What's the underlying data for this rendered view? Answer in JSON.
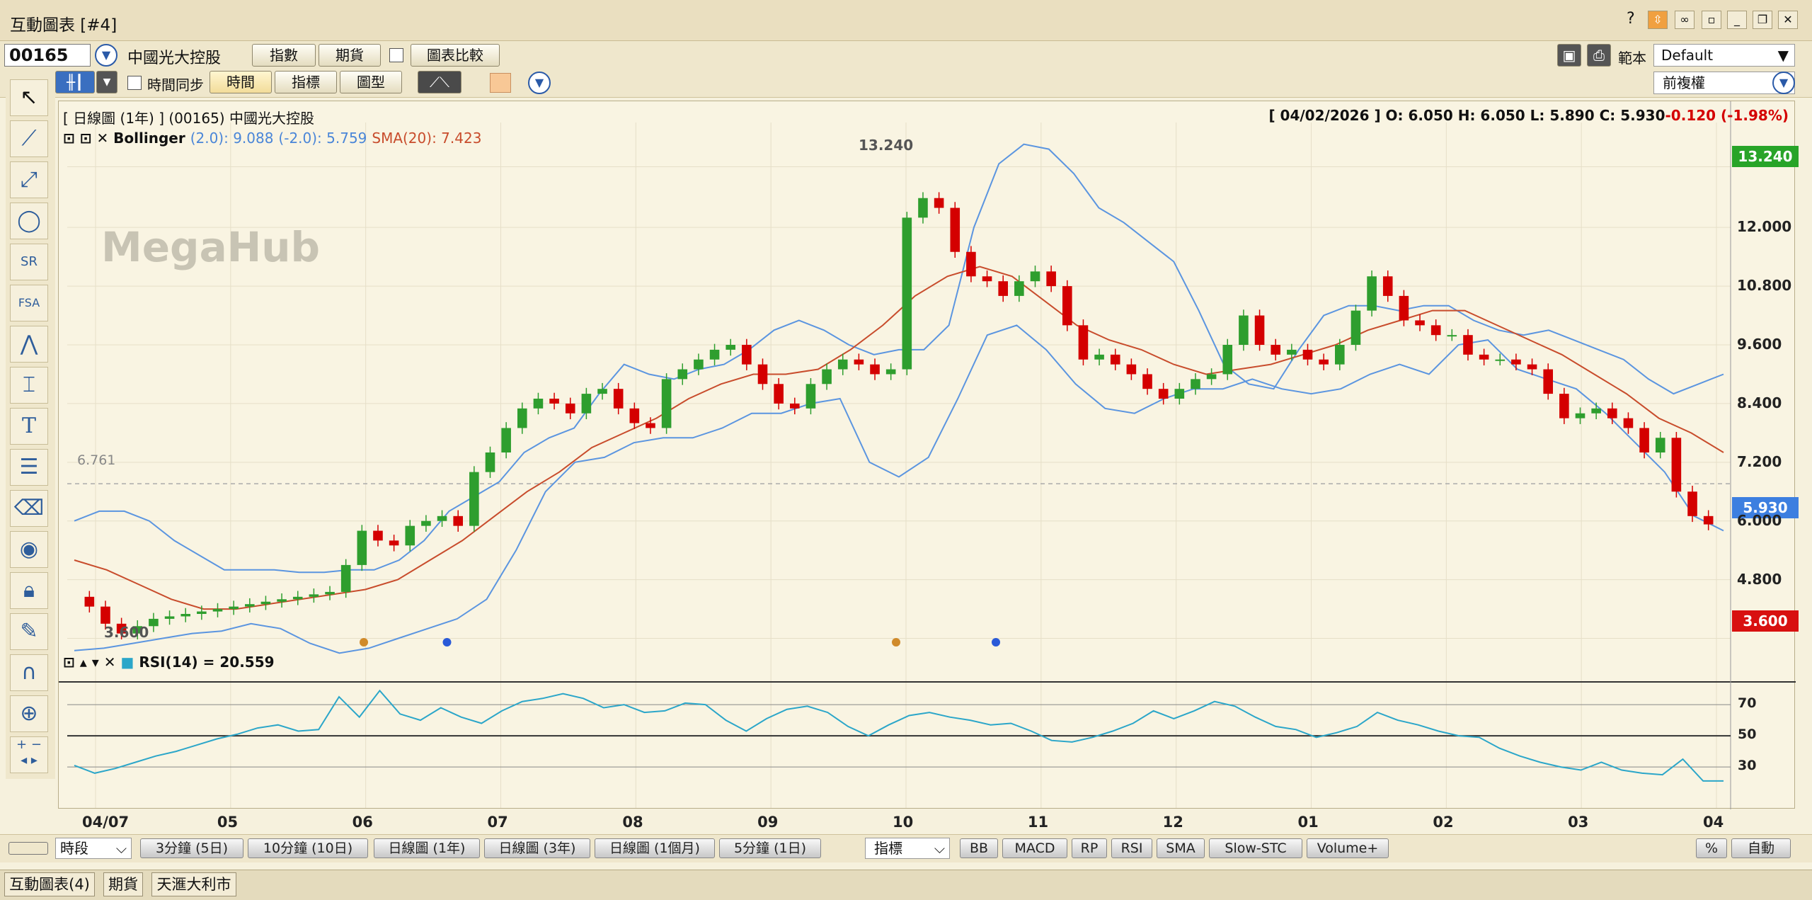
{
  "window": {
    "title": "互動圖表 [#4]",
    "help": "?"
  },
  "toolbar1": {
    "code": "00165",
    "name": "中國光大控股",
    "btn_index": "指數",
    "btn_futures": "期貨",
    "btn_compare": "圖表比較",
    "template_label": "範本",
    "template_value": "Default"
  },
  "toolbar2": {
    "time_sync": "時間同步",
    "btn_time": "時間",
    "btn_indicator": "指標",
    "btn_chart_type": "圖型",
    "adjust_value": "前複權"
  },
  "chart": {
    "header_title": "[ 日線圖 (1年) ]  (00165)  中國光大控股",
    "header_ohlc_prefix": "[ 04/02/2026 ]   O: 6.050   H: 6.050   L: 5.890   C: 5.930",
    "header_change": "-0.120 (-1.98%)",
    "boll_name": "Bollinger",
    "boll_upper": "(2.0): 9.088",
    "boll_lower": "(-2.0): 5.759",
    "sma_label": "SMA(20): 7.423",
    "watermark": "MegaHub",
    "label_high": "13.240",
    "label_low": "3.600",
    "label_ref": "6.761",
    "price_tag_high": "13.240",
    "price_tag_last": "5.930",
    "price_tag_low": "3.600",
    "rsi_label": "RSI(14) = 20.559",
    "colors": {
      "up": "#2e9e2e",
      "down": "#d40000",
      "band": "#5b95e0",
      "sma": "#c84c2c",
      "rsi": "#2ba6c9"
    }
  },
  "chart_data": {
    "type": "candlestick",
    "title": "日線圖 (1年) (00165) 中國光大控股",
    "y_ticks": [
      "13.240",
      "12.000",
      "10.800",
      "9.600",
      "8.400",
      "7.200",
      "6.000",
      "4.800",
      "3.600"
    ],
    "ylim": [
      3.0,
      14.0
    ],
    "x_ticks": [
      "04/07",
      "05",
      "06",
      "07",
      "08",
      "09",
      "10",
      "11",
      "12",
      "01",
      "02",
      "03",
      "04"
    ],
    "last": {
      "date": "04/02/2026",
      "open": 6.05,
      "high": 6.05,
      "low": 5.89,
      "close": 5.93,
      "change": -0.12,
      "change_pct": -1.98
    },
    "close_series": [
      4.25,
      3.9,
      3.7,
      3.85,
      4.0,
      4.05,
      4.1,
      4.15,
      4.2,
      4.25,
      4.3,
      4.35,
      4.4,
      4.45,
      4.5,
      4.55,
      5.1,
      5.8,
      5.6,
      5.5,
      5.9,
      6.0,
      6.1,
      5.9,
      7.0,
      7.4,
      7.9,
      8.3,
      8.5,
      8.4,
      8.2,
      8.6,
      8.7,
      8.3,
      8.0,
      7.9,
      8.9,
      9.1,
      9.3,
      9.5,
      9.6,
      9.2,
      8.8,
      8.4,
      8.3,
      8.8,
      9.1,
      9.3,
      9.2,
      9.0,
      9.1,
      12.2,
      12.6,
      12.4,
      11.5,
      11.0,
      10.9,
      10.6,
      10.9,
      11.1,
      10.8,
      10.0,
      9.3,
      9.4,
      9.2,
      9.0,
      8.7,
      8.5,
      8.7,
      8.9,
      9.0,
      9.6,
      10.2,
      9.6,
      9.4,
      9.5,
      9.3,
      9.2,
      9.6,
      10.3,
      11.0,
      10.6,
      10.1,
      10.0,
      9.8,
      9.8,
      9.4,
      9.3,
      9.3,
      9.2,
      9.1,
      8.6,
      8.1,
      8.2,
      8.3,
      8.1,
      7.9,
      7.4,
      7.7,
      6.6,
      6.1,
      5.93
    ],
    "upper_series": [
      6.0,
      6.2,
      6.2,
      6.0,
      5.6,
      5.3,
      5.0,
      5.0,
      5.0,
      4.95,
      4.95,
      5.0,
      5.0,
      5.2,
      5.6,
      6.2,
      6.5,
      6.8,
      7.4,
      7.7,
      7.9,
      8.6,
      9.2,
      9.0,
      8.9,
      9.1,
      9.2,
      9.5,
      9.9,
      10.1,
      9.9,
      9.6,
      9.4,
      9.5,
      9.5,
      10.0,
      12.0,
      13.3,
      13.7,
      13.6,
      13.1,
      12.4,
      12.1,
      11.7,
      11.3,
      10.3,
      9.2,
      8.8,
      8.7,
      9.5,
      10.2,
      10.4,
      10.4,
      10.3,
      10.4,
      10.4,
      10.1,
      9.9,
      9.8,
      9.9,
      9.7,
      9.5,
      9.3,
      8.9,
      8.6,
      8.8,
      9.0
    ],
    "lower_series": [
      3.35,
      3.4,
      3.5,
      3.6,
      3.7,
      3.75,
      3.9,
      3.8,
      3.5,
      3.3,
      3.4,
      3.6,
      3.8,
      4.0,
      4.4,
      5.4,
      6.6,
      7.2,
      7.3,
      7.6,
      7.7,
      7.7,
      7.9,
      8.2,
      8.2,
      8.4,
      8.5,
      7.2,
      6.9,
      7.3,
      8.5,
      9.8,
      10.0,
      9.5,
      8.8,
      8.3,
      8.2,
      8.5,
      8.7,
      8.7,
      8.9,
      8.7,
      8.6,
      8.7,
      9.0,
      9.2,
      9.0,
      9.6,
      9.7,
      9.1,
      8.9,
      8.7,
      8.2,
      7.6,
      7.0,
      6.1,
      5.8
    ],
    "sma_series": [
      5.2,
      5.0,
      4.7,
      4.4,
      4.2,
      4.2,
      4.3,
      4.4,
      4.5,
      4.6,
      4.8,
      5.2,
      5.6,
      6.1,
      6.6,
      7.0,
      7.5,
      7.8,
      8.1,
      8.5,
      8.8,
      9.0,
      9.0,
      9.1,
      9.5,
      10.0,
      10.6,
      11.0,
      11.2,
      11.0,
      10.5,
      10.0,
      9.7,
      9.5,
      9.2,
      9.0,
      9.1,
      9.2,
      9.4,
      9.6,
      9.9,
      10.1,
      10.3,
      10.3,
      10.0,
      9.7,
      9.4,
      9.0,
      8.6,
      8.1,
      7.8,
      7.4
    ],
    "rsi_series": [
      31,
      26,
      29,
      33,
      37,
      40,
      44,
      48,
      51,
      55,
      57,
      53,
      54,
      75,
      62,
      79,
      64,
      60,
      68,
      62,
      58,
      66,
      72,
      74,
      77,
      74,
      68,
      70,
      65,
      66,
      71,
      70,
      60,
      53,
      61,
      67,
      69,
      65,
      56,
      50,
      57,
      63,
      65,
      62,
      60,
      57,
      58,
      53,
      47,
      46,
      49,
      53,
      58,
      66,
      61,
      66,
      72,
      69,
      62,
      56,
      54,
      49,
      52,
      56,
      65,
      60,
      57,
      53,
      50,
      49,
      42,
      37,
      33,
      30,
      28,
      33,
      28,
      26,
      25,
      35,
      21,
      21
    ],
    "rsi_levels": [
      70,
      50,
      30
    ]
  },
  "bottom": {
    "period_label": "時段",
    "periods": [
      "3分鐘 (5日)",
      "10分鐘 (10日)",
      "日線圖 (1年)",
      "日線圖 (3年)",
      "日線圖 (1個月)",
      "5分鐘 (1日)"
    ],
    "ind_label": "指標",
    "indicators": [
      "BB",
      "MACD",
      "RP",
      "RSI",
      "SMA",
      "Slow-STC",
      "Volume+"
    ],
    "pct": "%",
    "auto": "自動"
  },
  "status_tabs": [
    "互動圖表(4)",
    "期貨",
    "天滙大利市"
  ]
}
